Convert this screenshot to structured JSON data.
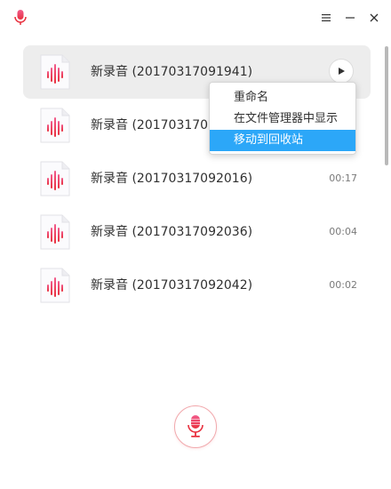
{
  "titlebar": {
    "app_icon": "microphone-icon",
    "menu_icon": "hamburger-menu-icon",
    "minimize_icon": "minimize-icon",
    "close_icon": "close-icon"
  },
  "recordings": [
    {
      "title": "新录音 (20170317091941)",
      "duration": "",
      "selected": true
    },
    {
      "title": "新录音 (20170317091",
      "duration": "",
      "selected": false
    },
    {
      "title": "新录音 (20170317092016)",
      "duration": "00:17",
      "selected": false
    },
    {
      "title": "新录音 (20170317092036)",
      "duration": "00:04",
      "selected": false
    },
    {
      "title": "新录音 (20170317092042)",
      "duration": "00:02",
      "selected": false
    }
  ],
  "context_menu": {
    "items": [
      "重命名",
      "在文件管理器中显示",
      "移动到回收站"
    ],
    "highlighted_index": 2
  },
  "colors": {
    "accent": "#ef4a5a",
    "menu_highlight": "#2ca7f8",
    "selected_row": "#ededed"
  }
}
